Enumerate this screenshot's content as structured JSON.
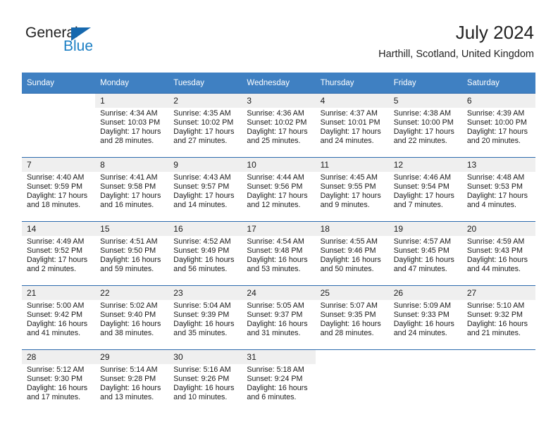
{
  "brand": {
    "name_part1": "General",
    "name_part2": "Blue",
    "accent_color": "#1668ae",
    "logo_icon": "triangle-flag-icon"
  },
  "header": {
    "title": "July 2024",
    "subtitle": "Harthill, Scotland, United Kingdom"
  },
  "calendar": {
    "header_bg": "#3f80c2",
    "daynum_bg": "#efefef",
    "weekday_names": [
      "Sunday",
      "Monday",
      "Tuesday",
      "Wednesday",
      "Thursday",
      "Friday",
      "Saturday"
    ],
    "weeks": [
      [
        {
          "day": "",
          "lines": []
        },
        {
          "day": "1",
          "lines": [
            "Sunrise: 4:34 AM",
            "Sunset: 10:03 PM",
            "Daylight: 17 hours",
            "and 28 minutes."
          ]
        },
        {
          "day": "2",
          "lines": [
            "Sunrise: 4:35 AM",
            "Sunset: 10:02 PM",
            "Daylight: 17 hours",
            "and 27 minutes."
          ]
        },
        {
          "day": "3",
          "lines": [
            "Sunrise: 4:36 AM",
            "Sunset: 10:02 PM",
            "Daylight: 17 hours",
            "and 25 minutes."
          ]
        },
        {
          "day": "4",
          "lines": [
            "Sunrise: 4:37 AM",
            "Sunset: 10:01 PM",
            "Daylight: 17 hours",
            "and 24 minutes."
          ]
        },
        {
          "day": "5",
          "lines": [
            "Sunrise: 4:38 AM",
            "Sunset: 10:00 PM",
            "Daylight: 17 hours",
            "and 22 minutes."
          ]
        },
        {
          "day": "6",
          "lines": [
            "Sunrise: 4:39 AM",
            "Sunset: 10:00 PM",
            "Daylight: 17 hours",
            "and 20 minutes."
          ]
        }
      ],
      [
        {
          "day": "7",
          "lines": [
            "Sunrise: 4:40 AM",
            "Sunset: 9:59 PM",
            "Daylight: 17 hours",
            "and 18 minutes."
          ]
        },
        {
          "day": "8",
          "lines": [
            "Sunrise: 4:41 AM",
            "Sunset: 9:58 PM",
            "Daylight: 17 hours",
            "and 16 minutes."
          ]
        },
        {
          "day": "9",
          "lines": [
            "Sunrise: 4:43 AM",
            "Sunset: 9:57 PM",
            "Daylight: 17 hours",
            "and 14 minutes."
          ]
        },
        {
          "day": "10",
          "lines": [
            "Sunrise: 4:44 AM",
            "Sunset: 9:56 PM",
            "Daylight: 17 hours",
            "and 12 minutes."
          ]
        },
        {
          "day": "11",
          "lines": [
            "Sunrise: 4:45 AM",
            "Sunset: 9:55 PM",
            "Daylight: 17 hours",
            "and 9 minutes."
          ]
        },
        {
          "day": "12",
          "lines": [
            "Sunrise: 4:46 AM",
            "Sunset: 9:54 PM",
            "Daylight: 17 hours",
            "and 7 minutes."
          ]
        },
        {
          "day": "13",
          "lines": [
            "Sunrise: 4:48 AM",
            "Sunset: 9:53 PM",
            "Daylight: 17 hours",
            "and 4 minutes."
          ]
        }
      ],
      [
        {
          "day": "14",
          "lines": [
            "Sunrise: 4:49 AM",
            "Sunset: 9:52 PM",
            "Daylight: 17 hours",
            "and 2 minutes."
          ]
        },
        {
          "day": "15",
          "lines": [
            "Sunrise: 4:51 AM",
            "Sunset: 9:50 PM",
            "Daylight: 16 hours",
            "and 59 minutes."
          ]
        },
        {
          "day": "16",
          "lines": [
            "Sunrise: 4:52 AM",
            "Sunset: 9:49 PM",
            "Daylight: 16 hours",
            "and 56 minutes."
          ]
        },
        {
          "day": "17",
          "lines": [
            "Sunrise: 4:54 AM",
            "Sunset: 9:48 PM",
            "Daylight: 16 hours",
            "and 53 minutes."
          ]
        },
        {
          "day": "18",
          "lines": [
            "Sunrise: 4:55 AM",
            "Sunset: 9:46 PM",
            "Daylight: 16 hours",
            "and 50 minutes."
          ]
        },
        {
          "day": "19",
          "lines": [
            "Sunrise: 4:57 AM",
            "Sunset: 9:45 PM",
            "Daylight: 16 hours",
            "and 47 minutes."
          ]
        },
        {
          "day": "20",
          "lines": [
            "Sunrise: 4:59 AM",
            "Sunset: 9:43 PM",
            "Daylight: 16 hours",
            "and 44 minutes."
          ]
        }
      ],
      [
        {
          "day": "21",
          "lines": [
            "Sunrise: 5:00 AM",
            "Sunset: 9:42 PM",
            "Daylight: 16 hours",
            "and 41 minutes."
          ]
        },
        {
          "day": "22",
          "lines": [
            "Sunrise: 5:02 AM",
            "Sunset: 9:40 PM",
            "Daylight: 16 hours",
            "and 38 minutes."
          ]
        },
        {
          "day": "23",
          "lines": [
            "Sunrise: 5:04 AM",
            "Sunset: 9:39 PM",
            "Daylight: 16 hours",
            "and 35 minutes."
          ]
        },
        {
          "day": "24",
          "lines": [
            "Sunrise: 5:05 AM",
            "Sunset: 9:37 PM",
            "Daylight: 16 hours",
            "and 31 minutes."
          ]
        },
        {
          "day": "25",
          "lines": [
            "Sunrise: 5:07 AM",
            "Sunset: 9:35 PM",
            "Daylight: 16 hours",
            "and 28 minutes."
          ]
        },
        {
          "day": "26",
          "lines": [
            "Sunrise: 5:09 AM",
            "Sunset: 9:33 PM",
            "Daylight: 16 hours",
            "and 24 minutes."
          ]
        },
        {
          "day": "27",
          "lines": [
            "Sunrise: 5:10 AM",
            "Sunset: 9:32 PM",
            "Daylight: 16 hours",
            "and 21 minutes."
          ]
        }
      ],
      [
        {
          "day": "28",
          "lines": [
            "Sunrise: 5:12 AM",
            "Sunset: 9:30 PM",
            "Daylight: 16 hours",
            "and 17 minutes."
          ]
        },
        {
          "day": "29",
          "lines": [
            "Sunrise: 5:14 AM",
            "Sunset: 9:28 PM",
            "Daylight: 16 hours",
            "and 13 minutes."
          ]
        },
        {
          "day": "30",
          "lines": [
            "Sunrise: 5:16 AM",
            "Sunset: 9:26 PM",
            "Daylight: 16 hours",
            "and 10 minutes."
          ]
        },
        {
          "day": "31",
          "lines": [
            "Sunrise: 5:18 AM",
            "Sunset: 9:24 PM",
            "Daylight: 16 hours",
            "and 6 minutes."
          ]
        },
        {
          "day": "",
          "lines": []
        },
        {
          "day": "",
          "lines": []
        },
        {
          "day": "",
          "lines": []
        }
      ]
    ]
  }
}
